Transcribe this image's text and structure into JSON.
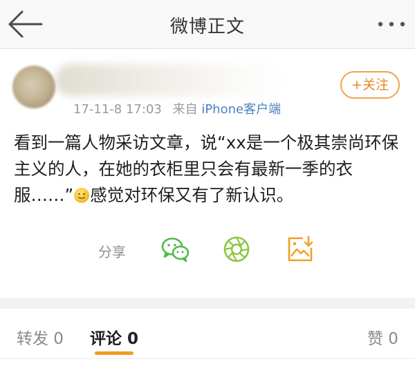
{
  "header": {
    "title": "微博正文"
  },
  "post": {
    "timestamp": "17-11-8 17:03",
    "source_prefix": "来自",
    "source": "iPhone客户端",
    "follow_label": "+关注",
    "text_before_emoji": "看到一篇人物采访文章，说“xx是一个极其崇尚环保主义的人，在她的衣柜里只会有最新一季的衣服……”",
    "text_after_emoji": "感觉对环保又有了新认识。"
  },
  "share": {
    "label": "分享",
    "icons": [
      "wechat-icon",
      "moments-icon",
      "save-image-icon"
    ]
  },
  "tabs": {
    "repost": "转发 0",
    "comment": "评论 0",
    "like": "赞 0"
  },
  "colors": {
    "accent_orange": "#f39a1e",
    "link_blue": "#4a80c2",
    "wechat_green": "#53b84a",
    "moments_green": "#8cc63f",
    "save_orange": "#f0a020"
  }
}
